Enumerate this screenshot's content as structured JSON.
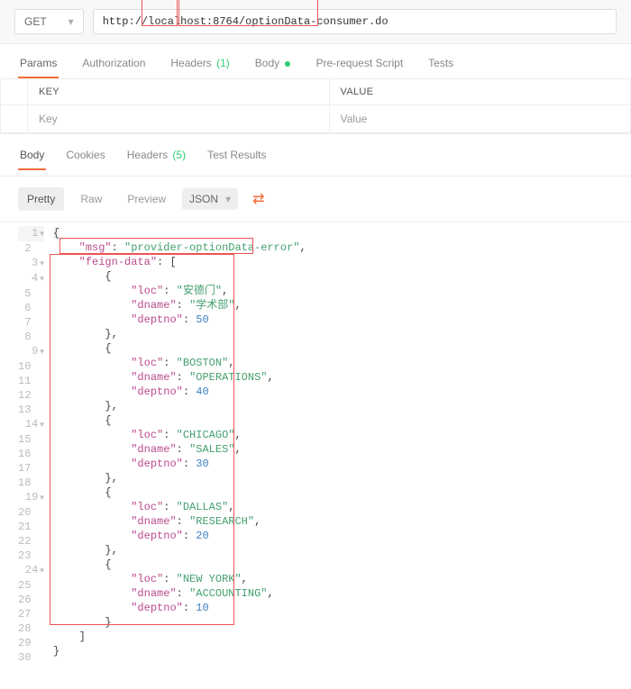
{
  "method": "GET",
  "url": "http://localhost:8764/optionData-consumer.do",
  "reqTabs": {
    "params": "Params",
    "authorization": "Authorization",
    "headers": "Headers",
    "headersCount": "(1)",
    "body": "Body",
    "prerequest": "Pre-request Script",
    "tests": "Tests"
  },
  "kv": {
    "keyHeader": "KEY",
    "valueHeader": "VALUE",
    "keyPh": "Key",
    "valuePh": "Value"
  },
  "respTabs": {
    "body": "Body",
    "cookies": "Cookies",
    "headers": "Headers",
    "headersCount": "(5)",
    "testResults": "Test Results"
  },
  "viewButtons": {
    "pretty": "Pretty",
    "raw": "Raw",
    "preview": "Preview",
    "json": "JSON"
  },
  "response": {
    "msgKey": "\"msg\"",
    "msgVal": "\"provider-optionData-error\"",
    "feignKey": "\"feign-data\"",
    "records": [
      {
        "loc": "\"安德门\"",
        "dname": "\"学术部\"",
        "deptno": "50"
      },
      {
        "loc": "\"BOSTON\"",
        "dname": "\"OPERATIONS\"",
        "deptno": "40"
      },
      {
        "loc": "\"CHICAGO\"",
        "dname": "\"SALES\"",
        "deptno": "30"
      },
      {
        "loc": "\"DALLAS\"",
        "dname": "\"RESEARCH\"",
        "deptno": "20"
      },
      {
        "loc": "\"NEW YORK\"",
        "dname": "\"ACCOUNTING\"",
        "deptno": "10"
      }
    ],
    "locKey": "\"loc\"",
    "dnameKey": "\"dname\"",
    "deptnoKey": "\"deptno\""
  }
}
